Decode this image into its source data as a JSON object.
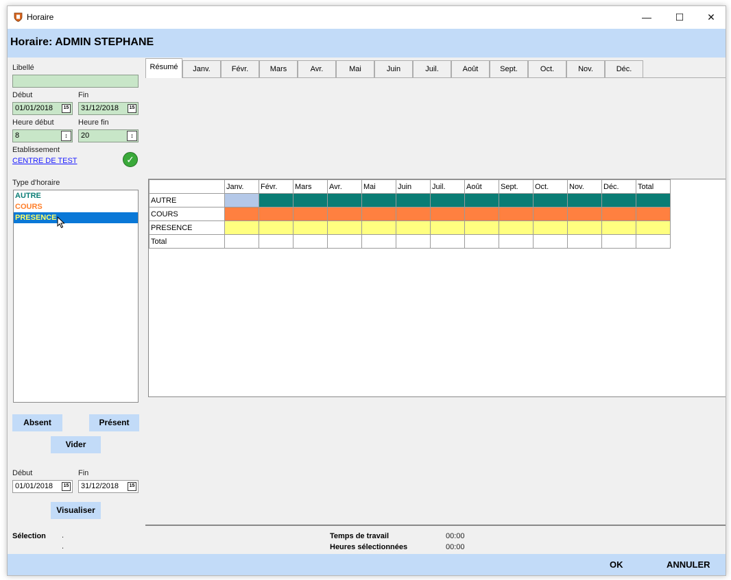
{
  "window": {
    "title": "Horaire",
    "minimize": "—",
    "maximize": "☐",
    "close": "✕"
  },
  "header": {
    "title": "Horaire: ADMIN STEPHANE"
  },
  "form": {
    "libelle_label": "Libellé",
    "libelle_value": "",
    "debut_label": "Début",
    "debut_value": "01/01/2018",
    "fin_label": "Fin",
    "fin_value": "31/12/2018",
    "heure_debut_label": "Heure début",
    "heure_debut_value": "8",
    "heure_fin_label": "Heure fin",
    "heure_fin_value": "20",
    "etablissement_label": "Etablissement",
    "etablissement_link": "CENTRE DE TEST",
    "calendar_glyph": "15",
    "spin_glyph": "↕"
  },
  "type_horaire": {
    "label": "Type d'horaire",
    "items": [
      {
        "label": "AUTRE",
        "color": "#0a7d75"
      },
      {
        "label": "COURS",
        "color": "#ff7f2a"
      },
      {
        "label": "PRESENCE",
        "color": "#ffff66"
      }
    ],
    "selected": "PRESENCE"
  },
  "buttons": {
    "absent": "Absent",
    "present": "Présent",
    "vider": "Vider",
    "visualiser": "Visualiser"
  },
  "visu": {
    "debut_label": "Début",
    "debut_value": "01/01/2018",
    "fin_label": "Fin",
    "fin_value": "31/12/2018"
  },
  "tabs": [
    "Résumé",
    "Janv.",
    "Févr.",
    "Mars",
    "Avr.",
    "Mai",
    "Juin",
    "Juil.",
    "Août",
    "Sept.",
    "Oct.",
    "Nov.",
    "Déc."
  ],
  "active_tab": "Résumé",
  "summary": {
    "columns": [
      "Janv.",
      "Févr.",
      "Mars",
      "Avr.",
      "Mai",
      "Juin",
      "Juil.",
      "Août",
      "Sept.",
      "Oct.",
      "Nov.",
      "Déc.",
      "Total"
    ],
    "rows": [
      {
        "label": "AUTRE",
        "color": "#0a7d75",
        "first_cell_color": "#b4c8e8"
      },
      {
        "label": "COURS",
        "color": "#ff8040"
      },
      {
        "label": "PRESENCE",
        "color": "#ffff80"
      },
      {
        "label": "Total",
        "color": "#ffffff"
      }
    ]
  },
  "status": {
    "selection_label": "Sélection",
    "selection_value1": ".",
    "selection_value2": ".",
    "temps_label": "Temps de travail",
    "temps_value": "00:00",
    "heures_label": "Heures sélectionnées",
    "heures_value": "00:00"
  },
  "footer": {
    "ok": "OK",
    "annuler": "ANNULER"
  }
}
